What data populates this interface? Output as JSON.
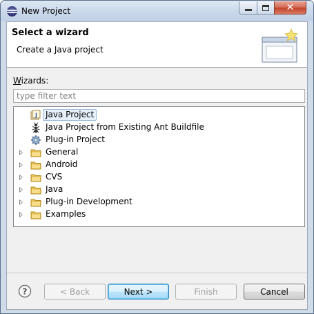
{
  "window": {
    "title": "New Project"
  },
  "header": {
    "title": "Select a wizard",
    "description": "Create a Java project"
  },
  "wizards": {
    "label_mnemonic": "W",
    "label_rest": "izards:",
    "filter_placeholder": "type filter text"
  },
  "tree": {
    "items": [
      {
        "label": "Java Project",
        "icon": "java-project-icon",
        "expandable": false,
        "selected": true
      },
      {
        "label": "Java Project from Existing Ant Buildfile",
        "icon": "ant-icon",
        "expandable": false,
        "selected": false
      },
      {
        "label": "Plug-in Project",
        "icon": "plugin-project-icon",
        "expandable": false,
        "selected": false
      },
      {
        "label": "General",
        "icon": "folder-icon",
        "expandable": true,
        "selected": false
      },
      {
        "label": "Android",
        "icon": "folder-icon",
        "expandable": true,
        "selected": false
      },
      {
        "label": "CVS",
        "icon": "folder-icon",
        "expandable": true,
        "selected": false
      },
      {
        "label": "Java",
        "icon": "folder-icon",
        "expandable": true,
        "selected": false
      },
      {
        "label": "Plug-in Development",
        "icon": "folder-icon",
        "expandable": true,
        "selected": false
      },
      {
        "label": "Examples",
        "icon": "folder-icon",
        "expandable": true,
        "selected": false
      }
    ]
  },
  "buttons": {
    "back": "< Back",
    "next": "Next >",
    "finish": "Finish",
    "cancel": "Cancel"
  },
  "colors": {
    "folder": "#e9c45a",
    "selection": "#e6f0fa",
    "close_button": "#c4432c"
  }
}
